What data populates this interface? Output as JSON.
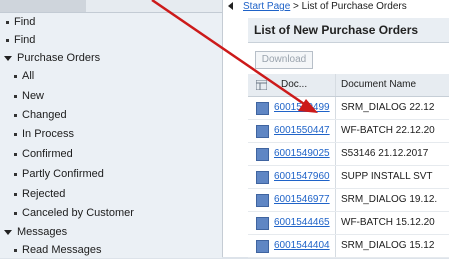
{
  "nav": {
    "items": [
      {
        "label": "Find",
        "type": "bullet",
        "indent": 1
      },
      {
        "label": "Find",
        "type": "bullet",
        "indent": 1
      },
      {
        "label": "Purchase Orders",
        "type": "expanded",
        "indent": 1
      },
      {
        "label": "All",
        "type": "bullet",
        "indent": 2
      },
      {
        "label": "New",
        "type": "bullet",
        "indent": 2
      },
      {
        "label": "Changed",
        "type": "bullet",
        "indent": 2
      },
      {
        "label": "In Process",
        "type": "bullet",
        "indent": 2
      },
      {
        "label": "Confirmed",
        "type": "bullet",
        "indent": 2
      },
      {
        "label": "Partly Confirmed",
        "type": "bullet",
        "indent": 2
      },
      {
        "label": "Rejected",
        "type": "bullet",
        "indent": 2
      },
      {
        "label": "Canceled by Customer",
        "type": "bullet",
        "indent": 2
      },
      {
        "label": "Messages",
        "type": "expanded",
        "indent": 1
      },
      {
        "label": "Read Messages",
        "type": "bullet",
        "indent": 2
      }
    ]
  },
  "breadcrumb": {
    "start": "Start Page",
    "separator": ">",
    "current": "List of Purchase Orders"
  },
  "list": {
    "title": "List of New Purchase Orders",
    "download_label": "Download",
    "columns": {
      "doc": "Doc...",
      "name": "Document Name"
    },
    "rows": [
      {
        "num": "6001550499",
        "name": "SRM_DIALOG 22.12"
      },
      {
        "num": "6001550447",
        "name": "WF-BATCH 22.12.20"
      },
      {
        "num": "6001549025",
        "name": "S53146 21.12.2017"
      },
      {
        "num": "6001547960",
        "name": "SUPP INSTALL SVT"
      },
      {
        "num": "6001546977",
        "name": "SRM_DIALOG 19.12."
      },
      {
        "num": "6001544465",
        "name": "WF-BATCH 15.12.20"
      },
      {
        "num": "6001544404",
        "name": "SRM_DIALOG 15.12"
      }
    ]
  },
  "colors": {
    "link": "#1f63c8",
    "arrow": "#cc1a1a",
    "checkbox": "#5f86c4"
  }
}
